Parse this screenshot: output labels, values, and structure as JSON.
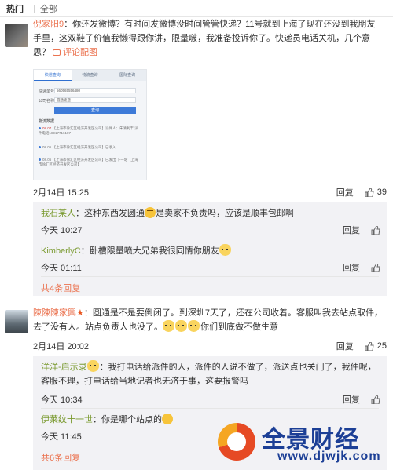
{
  "tabs": {
    "hot": "热门",
    "separator": "|",
    "all": "全部"
  },
  "comment1": {
    "user": "倪家阳9",
    "text": "：你还发微博？有时间发微博没时间管管快递？11号就到上海了现在还没到我朋友手里，这双鞋子价值我懒得跟你讲，限量啵，我准备投诉你了。快递员电话关机，几个意思？",
    "comment_pic": "评论配图",
    "time": "2月14日 15:25",
    "reply": "回复",
    "likes": "39",
    "screenshot": {
      "tabs": [
        "快递查询",
        "物流查询",
        "国际查询"
      ],
      "order_label": "快递单号:",
      "order_value": "560565556480",
      "company_label": "公司名称:",
      "company_value": "圆通速递",
      "query_btn": "查询",
      "result_title": "物流数据",
      "entries": [
        {
          "date": "08.07",
          "text": "【上海市徐汇区经济开发区公司】派件人：朱清利丰 派件电话18917716187"
        },
        {
          "date": "08.06",
          "text": "【上海市徐汇区经济开发区公司】已收入"
        },
        {
          "date": "08.05",
          "text": "【上海市徐汇区经济开发区公司】已发出 下一站【上海市徐汇区经济开发区公司】"
        }
      ]
    }
  },
  "comment1_replies": [
    {
      "user": "我石某人",
      "text": "：这种东西发圆通",
      "text2": "是卖家不负责吗，应该是顺丰包邮啊",
      "time": "今天 10:27",
      "reply": "回复",
      "like": "赞"
    },
    {
      "user": "KimberlyC",
      "text": "：卧槽限量喷大兄弟我很同情你朋友",
      "time": "今天 01:11",
      "reply": "回复",
      "like": "赞"
    }
  ],
  "comment1_more": "共4条回复",
  "comment2": {
    "user": "陳陳陳家興",
    "text1": "：圆通是不是要倒闭了。到深圳7天了，还在公司收着。客服叫我去站点取件，去了没有人。站点负责人也没了。",
    "text2": "你们到底做不做生意",
    "time": "2月14日 20:02",
    "reply": "回复",
    "likes": "25"
  },
  "comment2_replies": [
    {
      "user": "洋洋-启示录",
      "text": "：我打电话给派件的人，派件的人说不做了，派送点也关门了，我件呢，客服不理，打电话给当地记者也无济于事，这要报警吗",
      "time": "今天 10:34",
      "reply": "回复",
      "like": "赞"
    },
    {
      "user": "伊莱纹十一世",
      "text": "：你是哪个站点的",
      "time": "今天 11:45",
      "reply": "回复",
      "like": "赞"
    }
  ],
  "comment2_more": "共6条回复",
  "watermark": {
    "text": "全景财经",
    "url": "www.djwjk.com"
  },
  "colors": {
    "link": "#eb7350",
    "username_green": "#7a9a30",
    "reply_bg": "#f2f2f5"
  }
}
